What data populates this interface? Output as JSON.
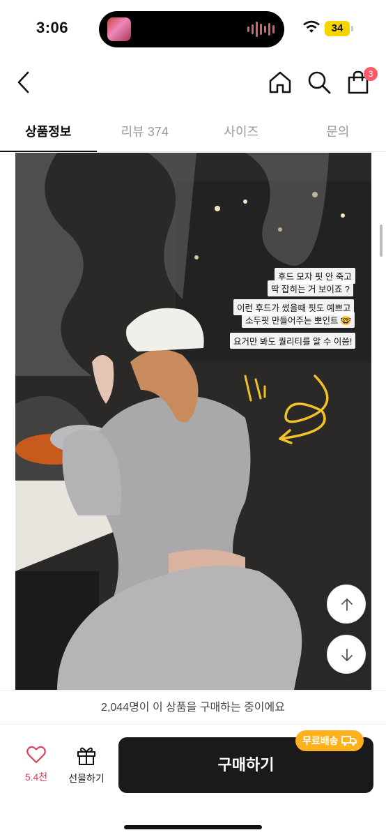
{
  "status_bar": {
    "time": "3:06",
    "battery": "34"
  },
  "nav": {
    "back_icon": "chevron-left-icon",
    "home_icon": "home-icon",
    "search_icon": "search-icon",
    "cart_icon": "shopping-bag-icon",
    "cart_badge": "3"
  },
  "tabs": [
    {
      "label": "상품정보",
      "active": true
    },
    {
      "label": "리뷰 374",
      "active": false
    },
    {
      "label": "사이즈",
      "active": false
    },
    {
      "label": "문의",
      "active": false
    }
  ],
  "product_image": {
    "captions": [
      "후드 모자 핏 안 죽고",
      "딱 잡히는 거 보이죠 ?",
      "이런 후드가 썼을때 핏도 예쁘고",
      "소두핏 만들어주는 뽀인트 🤓",
      "요거만 봐도 퀄리티를 알 수 이씀!"
    ]
  },
  "floating": {
    "up_icon": "arrow-up-icon",
    "down_icon": "arrow-down-icon"
  },
  "buying_notice": "2,044명이 이 상품을 구매하는 중이에요",
  "bottom_bar": {
    "like_count": "5.4천",
    "gift_label": "선물하기",
    "buy_label": "구매하기",
    "shipping_badge": "무료배송"
  },
  "colors": {
    "accent_pink": "#e0405a",
    "badge_red": "#ff5a6a",
    "shipping_orange": "#ffb21e",
    "buy_button": "#1a1a1a"
  }
}
